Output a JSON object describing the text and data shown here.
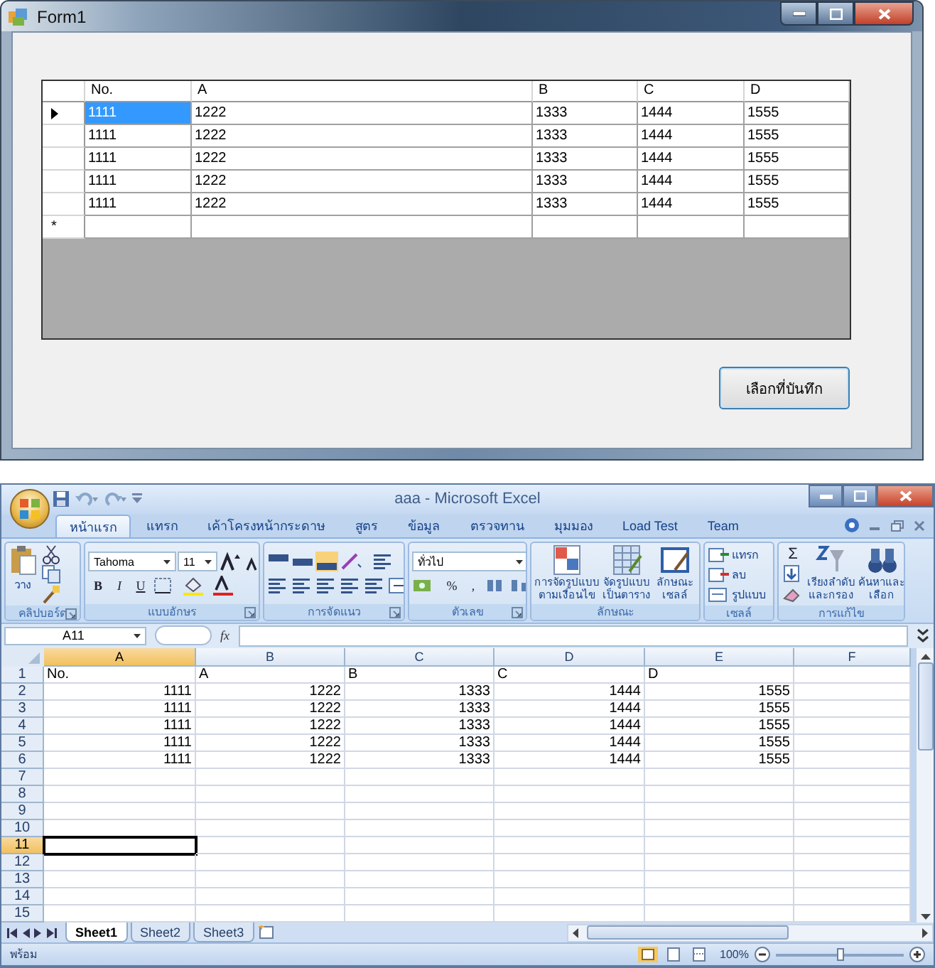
{
  "form_window": {
    "title": "Form1",
    "grid": {
      "columns": [
        "No.",
        "A",
        "B",
        "C",
        "D"
      ],
      "rows": [
        {
          "selected": true,
          "cells": [
            "1111",
            "1222",
            "1333",
            "1444",
            "1555"
          ]
        },
        {
          "selected": false,
          "cells": [
            "1111",
            "1222",
            "1333",
            "1444",
            "1555"
          ]
        },
        {
          "selected": false,
          "cells": [
            "1111",
            "1222",
            "1333",
            "1444",
            "1555"
          ]
        },
        {
          "selected": false,
          "cells": [
            "1111",
            "1222",
            "1333",
            "1444",
            "1555"
          ]
        },
        {
          "selected": false,
          "cells": [
            "1111",
            "1222",
            "1333",
            "1444",
            "1555"
          ]
        }
      ],
      "new_row": "*"
    },
    "button": "เลือกที่บันทึก"
  },
  "excel_window": {
    "title": "aaa - Microsoft Excel",
    "tabs": [
      {
        "label": "หน้าแรก",
        "selected": true
      },
      {
        "label": "แทรก",
        "selected": false
      },
      {
        "label": "เค้าโครงหน้ากระดาษ",
        "selected": false
      },
      {
        "label": "สูตร",
        "selected": false
      },
      {
        "label": "ข้อมูล",
        "selected": false
      },
      {
        "label": "ตรวจทาน",
        "selected": false
      },
      {
        "label": "มุมมอง",
        "selected": false
      },
      {
        "label": "Load Test",
        "selected": false
      },
      {
        "label": "Team",
        "selected": false
      }
    ],
    "ribbon": [
      {
        "kind": "clipboard",
        "label": "คลิปบอร์ด",
        "paste": "วาง"
      },
      {
        "kind": "font",
        "label": "แบบอักษร",
        "font": "Tahoma",
        "size": "11",
        "bold": "B",
        "italic": "I",
        "underline": "U"
      },
      {
        "kind": "alignment",
        "label": "การจัดแนว"
      },
      {
        "kind": "number",
        "label": "ตัวเลข",
        "format": "ทั่วไป",
        "percent": "%",
        "comma": ","
      },
      {
        "kind": "styles",
        "label": "ลักษณะ",
        "buttons": [
          "การจัดรูปแบบ\nตามเงื่อนไข",
          "จัดรูปแบบ\nเป็นตาราง",
          "ลักษณะ\nเซลล์"
        ]
      },
      {
        "kind": "cells",
        "label": "เซลล์",
        "buttons": [
          "แทรก",
          "ลบ",
          "รูปแบบ"
        ]
      },
      {
        "kind": "editing",
        "label": "การแก้ไข",
        "sum": "Σ",
        "buttons": [
          "เรียงลำดับ\nและกรอง",
          "ค้นหาและ\nเลือก"
        ]
      }
    ],
    "name_box": "A11",
    "fx": "fx",
    "columns": [
      {
        "label": "A",
        "selected": true
      },
      {
        "label": "B",
        "selected": false
      },
      {
        "label": "C",
        "selected": false
      },
      {
        "label": "D",
        "selected": false
      },
      {
        "label": "E",
        "selected": false
      },
      {
        "label": "F",
        "selected": false
      }
    ],
    "rows": [
      {
        "number": "1",
        "selected": false,
        "kind": "text",
        "cells": [
          "No.",
          "A",
          "B",
          "C",
          "D"
        ]
      },
      {
        "number": "2",
        "selected": false,
        "kind": "number",
        "cells": [
          "1111",
          "1222",
          "1333",
          "1444",
          "1555"
        ]
      },
      {
        "number": "3",
        "selected": false,
        "kind": "number",
        "cells": [
          "1111",
          "1222",
          "1333",
          "1444",
          "1555"
        ]
      },
      {
        "number": "4",
        "selected": false,
        "kind": "number",
        "cells": [
          "1111",
          "1222",
          "1333",
          "1444",
          "1555"
        ]
      },
      {
        "number": "5",
        "selected": false,
        "kind": "number",
        "cells": [
          "1111",
          "1222",
          "1333",
          "1444",
          "1555"
        ]
      },
      {
        "number": "6",
        "selected": false,
        "kind": "number",
        "cells": [
          "1111",
          "1222",
          "1333",
          "1444",
          "1555"
        ]
      },
      {
        "number": "7",
        "selected": false
      },
      {
        "number": "8",
        "selected": false
      },
      {
        "number": "9",
        "selected": false
      },
      {
        "number": "10",
        "selected": false
      },
      {
        "number": "11",
        "selected": true
      },
      {
        "number": "12",
        "selected": false
      },
      {
        "number": "13",
        "selected": false
      },
      {
        "number": "14",
        "selected": false
      },
      {
        "number": "15",
        "selected": false
      }
    ],
    "sheets": [
      {
        "label": "Sheet1",
        "selected": true
      },
      {
        "label": "Sheet2",
        "selected": false
      },
      {
        "label": "Sheet3",
        "selected": false
      }
    ],
    "status": "พร้อม",
    "zoom": {
      "reading": "100%",
      "level": 0.5
    }
  }
}
